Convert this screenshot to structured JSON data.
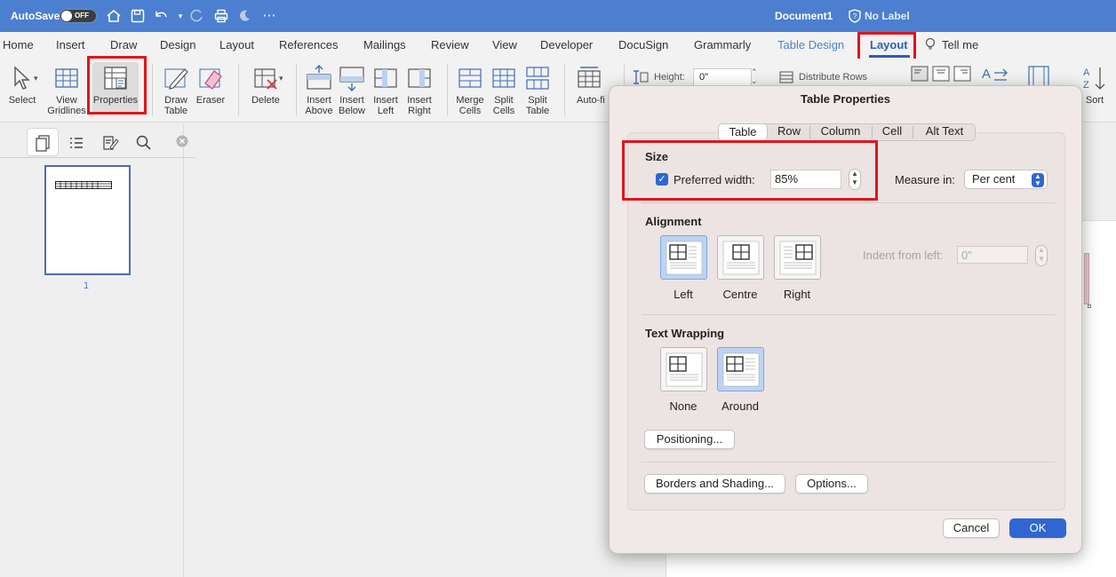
{
  "titlebar": {
    "autosave_label": "AutoSave",
    "autosave_state": "OFF",
    "document_title": "Document1",
    "label_status": "No Label"
  },
  "tabs": [
    {
      "label": "Home"
    },
    {
      "label": "Insert"
    },
    {
      "label": "Draw"
    },
    {
      "label": "Design"
    },
    {
      "label": "Layout"
    },
    {
      "label": "References"
    },
    {
      "label": "Mailings"
    },
    {
      "label": "Review"
    },
    {
      "label": "View"
    },
    {
      "label": "Developer"
    },
    {
      "label": "DocuSign"
    },
    {
      "label": "Grammarly"
    },
    {
      "label": "Table Design"
    },
    {
      "label": "Layout"
    },
    {
      "label": "Tell me"
    }
  ],
  "ribbon": {
    "select": "Select",
    "view_gridlines_1": "View",
    "view_gridlines_2": "Gridlines",
    "properties": "Properties",
    "draw_table_1": "Draw",
    "draw_table_2": "Table",
    "eraser": "Eraser",
    "delete": "Delete",
    "insert_above_1": "Insert",
    "insert_above_2": "Above",
    "insert_below_1": "Insert",
    "insert_below_2": "Below",
    "insert_left_1": "Insert",
    "insert_left_2": "Left",
    "insert_right_1": "Insert",
    "insert_right_2": "Right",
    "merge_cells_1": "Merge",
    "merge_cells_2": "Cells",
    "split_cells_1": "Split",
    "split_cells_2": "Cells",
    "split_table_1": "Split",
    "split_table_2": "Table",
    "autofit": "Auto-fi",
    "height_label": "Height:",
    "height_value": "0\"",
    "distribute_rows": "Distribute Rows",
    "sort": "Sort"
  },
  "sidebar": {
    "page_number": "1"
  },
  "dialog": {
    "title": "Table Properties",
    "tabs": [
      "Table",
      "Row",
      "Column",
      "Cell",
      "Alt Text"
    ],
    "selected_tab": "Table",
    "size": {
      "heading": "Size",
      "preferred_width_label": "Preferred width:",
      "preferred_width_checked": true,
      "preferred_width_value": "85%",
      "measure_in_label": "Measure in:",
      "measure_in_value": "Per cent"
    },
    "alignment": {
      "heading": "Alignment",
      "options": [
        "Left",
        "Centre",
        "Right"
      ],
      "selected": "Left",
      "indent_label": "Indent from left:",
      "indent_value": "0\""
    },
    "text_wrapping": {
      "heading": "Text Wrapping",
      "options": [
        "None",
        "Around"
      ],
      "selected": "Around"
    },
    "positioning_button": "Positioning...",
    "borders_button": "Borders and Shading...",
    "options_button": "Options...",
    "cancel_button": "Cancel",
    "ok_button": "OK"
  },
  "colors": {
    "titlebar": "#4c7fcf",
    "accent": "#2f67d1",
    "highlight_box": "#e3141b"
  }
}
